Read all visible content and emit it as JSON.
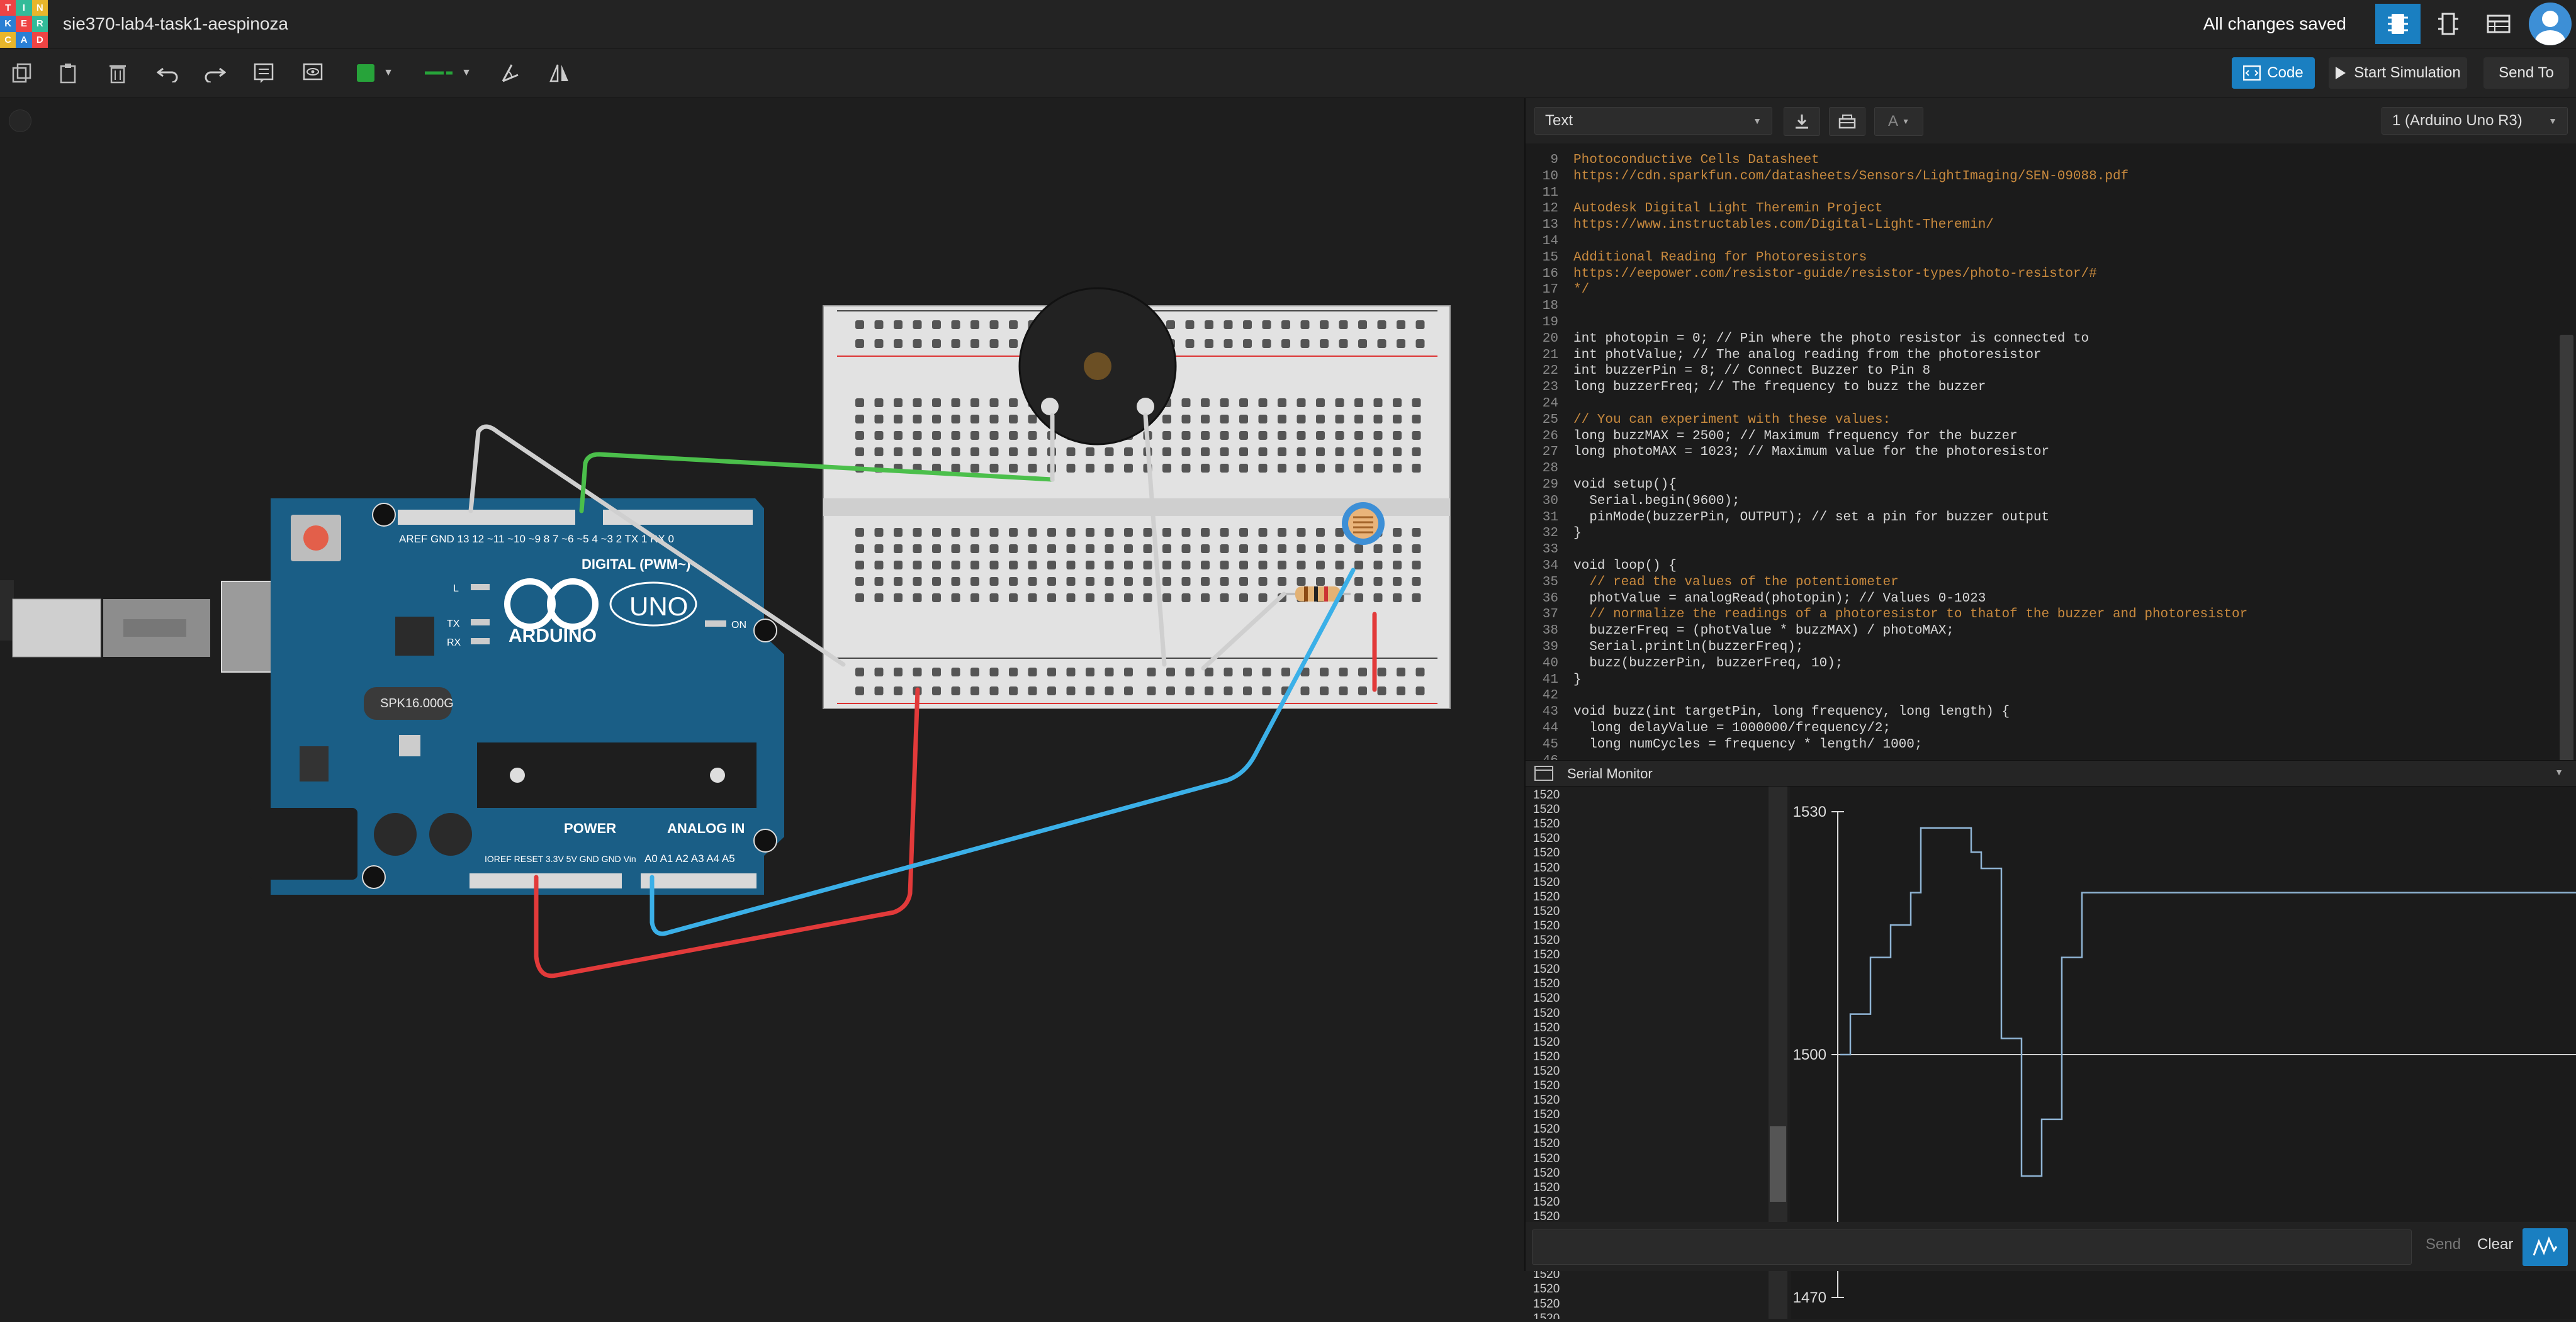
{
  "app": {
    "logo_letters": [
      "T",
      "I",
      "N",
      "K",
      "E",
      "R",
      "C",
      "A",
      "D"
    ],
    "project_title": "sie370-lab4-task1-aespinoza",
    "save_status": "All changes saved"
  },
  "toolbar": {
    "code_label": "Code",
    "start_sim_label": "Start Simulation",
    "send_to_label": "Send To"
  },
  "code_panel": {
    "mode_select": "Text",
    "board_select": "1 (Arduino Uno R3)",
    "lines": [
      {
        "n": "9",
        "t": "Photoconductive Cells Datasheet",
        "c": "c-cm"
      },
      {
        "n": "10",
        "t": "https://cdn.sparkfun.com/datasheets/Sensors/LightImaging/SEN-09088.pdf",
        "c": "c-cm"
      },
      {
        "n": "11",
        "t": "",
        "c": "c-cm"
      },
      {
        "n": "12",
        "t": "Autodesk Digital Light Theremin Project",
        "c": "c-cm"
      },
      {
        "n": "13",
        "t": "https://www.instructables.com/Digital-Light-Theremin/",
        "c": "c-cm"
      },
      {
        "n": "14",
        "t": "",
        "c": "c-cm"
      },
      {
        "n": "15",
        "t": "Additional Reading for Photoresistors",
        "c": "c-cm"
      },
      {
        "n": "16",
        "t": "https://eepower.com/resistor-guide/resistor-types/photo-resistor/#",
        "c": "c-cm"
      },
      {
        "n": "17",
        "t": "*/",
        "c": "c-cm"
      },
      {
        "n": "18",
        "t": "",
        "c": "c-tx"
      },
      {
        "n": "19",
        "t": "",
        "c": "c-tx"
      },
      {
        "n": "20",
        "t": "int photopin = 0; // Pin where the photo resistor is connected to",
        "c": "c-tx"
      },
      {
        "n": "21",
        "t": "int photValue; // The analog reading from the photoresistor",
        "c": "c-tx"
      },
      {
        "n": "22",
        "t": "int buzzerPin = 8; // Connect Buzzer to Pin 8",
        "c": "c-tx"
      },
      {
        "n": "23",
        "t": "long buzzerFreq; // The frequency to buzz the buzzer",
        "c": "c-tx"
      },
      {
        "n": "24",
        "t": "",
        "c": "c-tx"
      },
      {
        "n": "25",
        "t": "// You can experiment with these values:",
        "c": "c-cm"
      },
      {
        "n": "26",
        "t": "long buzzMAX = 2500; // Maximum frequency for the buzzer",
        "c": "c-tx"
      },
      {
        "n": "27",
        "t": "long photoMAX = 1023; // Maximum value for the photoresistor",
        "c": "c-tx"
      },
      {
        "n": "28",
        "t": "",
        "c": "c-tx"
      },
      {
        "n": "29",
        "t": "void setup(){",
        "c": "c-tx"
      },
      {
        "n": "30",
        "t": "  Serial.begin(9600);",
        "c": "c-tx"
      },
      {
        "n": "31",
        "t": "  pinMode(buzzerPin, OUTPUT); // set a pin for buzzer output",
        "c": "c-tx"
      },
      {
        "n": "32",
        "t": "}",
        "c": "c-tx"
      },
      {
        "n": "33",
        "t": "",
        "c": "c-tx"
      },
      {
        "n": "34",
        "t": "void loop() {",
        "c": "c-tx"
      },
      {
        "n": "35",
        "t": "  // read the values of the potentiometer",
        "c": "c-cm"
      },
      {
        "n": "36",
        "t": "  photValue = analogRead(photopin); // Values 0-1023",
        "c": "c-tx"
      },
      {
        "n": "37",
        "t": "  // normalize the readings of a photoresistor to thatof the buzzer and photoresistor",
        "c": "c-cm"
      },
      {
        "n": "38",
        "t": "  buzzerFreq = (photValue * buzzMAX) / photoMAX;",
        "c": "c-tx"
      },
      {
        "n": "39",
        "t": "  Serial.println(buzzerFreq);",
        "c": "c-tx"
      },
      {
        "n": "40",
        "t": "  buzz(buzzerPin, buzzerFreq, 10);",
        "c": "c-tx"
      },
      {
        "n": "41",
        "t": "}",
        "c": "c-tx"
      },
      {
        "n": "42",
        "t": "",
        "c": "c-tx"
      },
      {
        "n": "43",
        "t": "void buzz(int targetPin, long frequency, long length) {",
        "c": "c-tx"
      },
      {
        "n": "44",
        "t": "  long delayValue = 1000000/frequency/2;",
        "c": "c-tx"
      },
      {
        "n": "45",
        "t": "  long numCycles = frequency * length/ 1000;",
        "c": "c-tx"
      },
      {
        "n": "46",
        "t": "",
        "c": "c-tx"
      }
    ]
  },
  "serial_monitor": {
    "title": "Serial Monitor",
    "values": [
      "1520",
      "1520",
      "1520",
      "1520",
      "1520",
      "1520",
      "1520",
      "1520",
      "1520",
      "1520",
      "1520",
      "1520",
      "1520",
      "1520",
      "1520",
      "1520",
      "1520",
      "1520",
      "1520",
      "1520",
      "1520",
      "1520",
      "1520",
      "1520",
      "1520",
      "1520",
      "1520",
      "1520",
      "1520",
      "1520",
      "1520",
      "1520",
      "1520",
      "1520",
      "1520",
      "1520",
      "1520",
      "1520",
      "1520",
      "1520",
      "1520"
    ],
    "send_label": "Send",
    "clear_label": "Clear"
  },
  "chart_data": {
    "type": "line",
    "title": "",
    "xlabel": "",
    "ylabel": "",
    "ylim": [
      1470,
      1530
    ],
    "yticks": [
      1530,
      1500,
      1470
    ],
    "series": [
      {
        "values": [
          1500,
          1505,
          1505,
          1512,
          1512,
          1516,
          1516,
          1520,
          1528,
          1528,
          1528,
          1528,
          1528,
          1525,
          1523,
          1523,
          1502,
          1502,
          1485,
          1485,
          1492,
          1492,
          1512,
          1512,
          1520,
          1520,
          1520,
          1520,
          1520,
          1520,
          1520,
          1520,
          1520,
          1520,
          1520,
          1520,
          1520,
          1520,
          1520,
          1520,
          1520,
          1520,
          1520,
          1520,
          1520,
          1520,
          1520,
          1520,
          1520,
          1520
        ]
      }
    ],
    "line_color": "#8fb4d4"
  },
  "circuit": {
    "arduino_text": "ARDUINO",
    "uno_text": "UNO",
    "digital_label": "DIGITAL (PWM~)",
    "power_label": "POWER",
    "analog_label": "ANALOG IN",
    "chip_label": "SPK16.000G",
    "on_label": "ON",
    "l_label": "L",
    "tx_label": "TX",
    "rx_label": "RX",
    "top_pins": "AREF GND 13 12 ~11 ~10 ~9 8   7 ~6 ~5 4 ~3 2 TX 1 RX 0",
    "power_pins": "IOREF RESET 3.3V 5V GND GND Vin",
    "analog_pins": "A0 A1 A2 A3 A4 A5"
  }
}
